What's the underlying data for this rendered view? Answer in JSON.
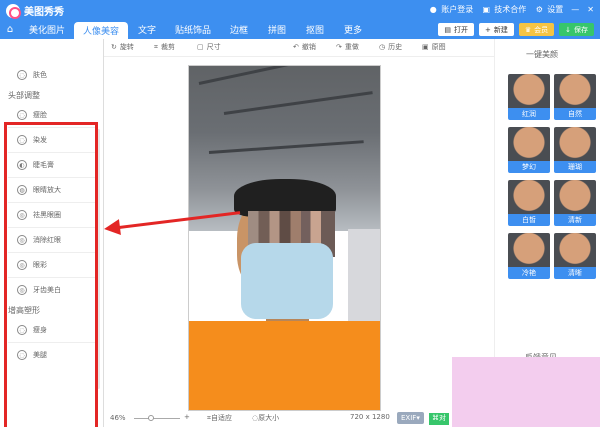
{
  "app": {
    "name": "美图秀秀"
  },
  "titlebar": {
    "login": "账户登录",
    "support": "技术合作",
    "settings": "设置"
  },
  "nav": {
    "tabs": [
      "美化图片",
      "人像美容",
      "文字",
      "贴纸饰品",
      "边框",
      "拼图",
      "抠图",
      "更多"
    ],
    "actions": {
      "open": "打开",
      "new": "新建",
      "vip": "会员",
      "save": "保存"
    }
  },
  "left_panel": {
    "top_items": [
      "肤色"
    ],
    "section_head": "头部调整",
    "head_items": [
      "瘦脸",
      "染发",
      "睫毛膏",
      "眼睛放大",
      "祛黑眼圈",
      "消除红眼",
      "眼彩",
      "牙齿美白"
    ],
    "section_body": "增高塑形",
    "body_items": [
      "瘦身",
      "美腿"
    ]
  },
  "toolbar": {
    "rotate": "旋转",
    "crop": "裁剪",
    "size": "尺寸",
    "undo": "撤销",
    "redo": "重做",
    "history": "历史",
    "original": "原图"
  },
  "status": {
    "zoom": "46%",
    "fit": "自适应",
    "original_size": "原大小",
    "dimensions": "720 x 1280",
    "exif": "EXIF",
    "compare": "对"
  },
  "right_panel": {
    "title": "一键美颜",
    "filters": [
      "红润",
      "自然",
      "梦幻",
      "珊瑚",
      "白皙",
      "清新",
      "冷艳",
      "清晰"
    ],
    "feedback": "反馈意见"
  },
  "colors": {
    "accent": "#3d8ff0",
    "red_annotation": "#e32625"
  }
}
